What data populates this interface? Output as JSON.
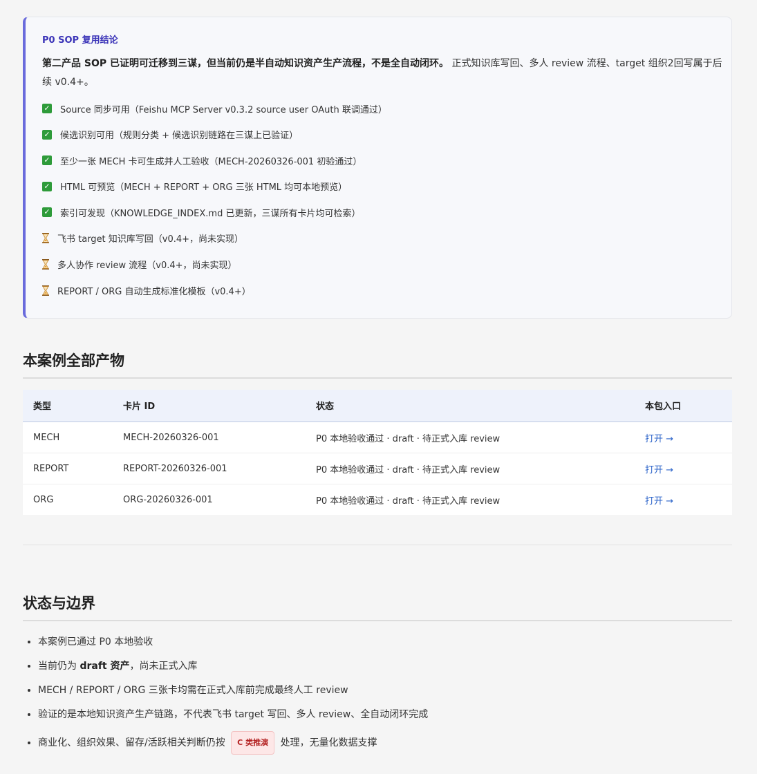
{
  "callout": {
    "title": "P0 SOP 复用结论",
    "summary_bold": "第二产品 SOP 已证明可迁移到三谋，但当前仍是半自动知识资产生产流程，不是全自动闭环。",
    "summary_rest": " 正式知识库写回、多人 review 流程、target 组织2回写属于后续 v0.4+。",
    "items": [
      {
        "status": "done",
        "icon": "check-icon",
        "text": "Source 同步可用（Feishu MCP Server v0.3.2 source user OAuth 联调通过）"
      },
      {
        "status": "done",
        "icon": "check-icon",
        "text": "候选识别可用（规则分类 + 候选识别链路在三谋上已验证）"
      },
      {
        "status": "done",
        "icon": "check-icon",
        "text": "至少一张 MECH 卡可生成并人工验收（MECH-20260326-001 初验通过）"
      },
      {
        "status": "done",
        "icon": "check-icon",
        "text": "HTML 可预览（MECH + REPORT + ORG 三张 HTML 均可本地预览）"
      },
      {
        "status": "done",
        "icon": "check-icon",
        "text": "索引可发现（KNOWLEDGE_INDEX.md 已更新，三谋所有卡片均可检索）"
      },
      {
        "status": "pending",
        "icon": "hourglass-icon",
        "text": "飞书 target 知识库写回（v0.4+，尚未实现）"
      },
      {
        "status": "pending",
        "icon": "hourglass-icon",
        "text": "多人协作 review 流程（v0.4+，尚未实现）"
      },
      {
        "status": "pending",
        "icon": "hourglass-icon",
        "text": "REPORT / ORG 自动生成标准化模板（v0.4+）"
      }
    ]
  },
  "artifacts": {
    "heading": "本案例全部产物",
    "columns": [
      "类型",
      "卡片 ID",
      "状态",
      "本包入口"
    ],
    "rows": [
      {
        "type": "MECH",
        "id": "MECH-20260326-001",
        "status": "P0 本地验收通过 · draft · 待正式入库 review",
        "link": "打开 →"
      },
      {
        "type": "REPORT",
        "id": "REPORT-20260326-001",
        "status": "P0 本地验收通过 · draft · 待正式入库 review",
        "link": "打开 →"
      },
      {
        "type": "ORG",
        "id": "ORG-20260326-001",
        "status": "P0 本地验收通过 · draft · 待正式入库 review",
        "link": "打开 →"
      }
    ]
  },
  "boundary": {
    "heading": "状态与边界",
    "items": [
      {
        "text": "本案例已通过 P0 本地验收"
      },
      {
        "pre": "当前仍为 ",
        "bold": "draft 资产",
        "post": "，尚未正式入库"
      },
      {
        "text": "MECH / REPORT / ORG 三张卡均需在正式入库前完成最终人工 review"
      },
      {
        "text": "验证的是本地知识资产生产链路，不代表飞书 target 写回、多人 review、全自动闭环完成"
      },
      {
        "pre": "商业化、组织效果、留存/活跃相关判断仍按 ",
        "badge": "C 类推演",
        "post": " 处理，无量化数据支撑"
      }
    ]
  },
  "colors": {
    "accent": "#6a6bdc",
    "title": "#3b34b8",
    "link": "#2b63c9",
    "badge_bg": "#fde7e7",
    "badge_text": "#b42323",
    "check": "#2e9b3a"
  }
}
